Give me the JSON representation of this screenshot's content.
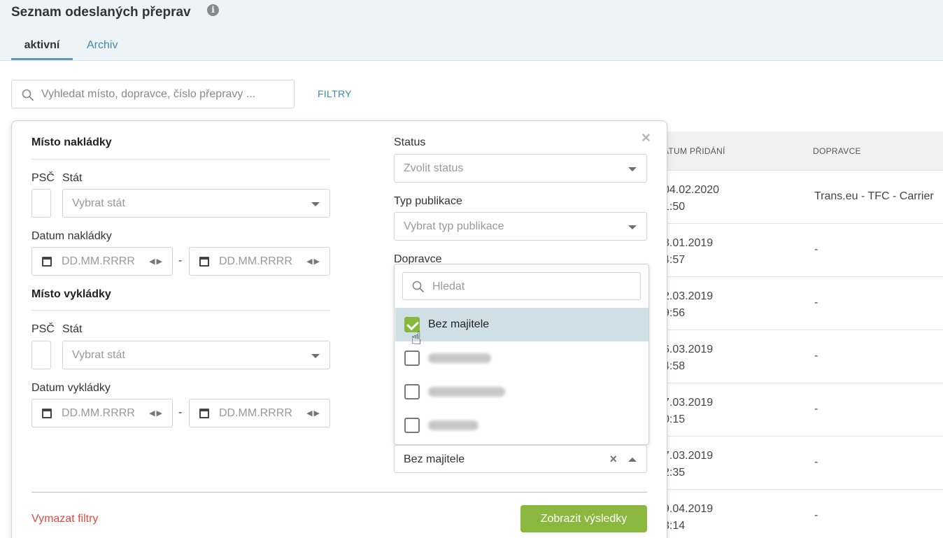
{
  "header": {
    "title": "Seznam odeslaných přeprav",
    "info_icon": "i",
    "tabs": [
      {
        "label": "aktivní",
        "active": true
      },
      {
        "label": "Archiv",
        "active": false
      }
    ]
  },
  "toolbar": {
    "search_placeholder": "Vyhledat místo, dopravce, číslo přepravy ...",
    "filters_label": "FILTRY"
  },
  "table": {
    "columns": [
      "ATUM PŘIDÁNÍ",
      "DOPRAVCE"
    ],
    "rows": [
      {
        "date": "04.02.2020",
        "time": "1:50",
        "carrier": "Trans.eu - TFC - Carrier"
      },
      {
        "date": "8.01.2019",
        "time": "4:57",
        "carrier": "-"
      },
      {
        "date": "2.03.2019",
        "time": "9:56",
        "carrier": "-"
      },
      {
        "date": "6.03.2019",
        "time": "4:58",
        "carrier": "-"
      },
      {
        "date": "7.03.2019",
        "time": "0:15",
        "carrier": "-"
      },
      {
        "date": "7.03.2019",
        "time": "2:35",
        "carrier": "-"
      },
      {
        "date": "9.04.2019",
        "time": "3:14",
        "carrier": "-"
      }
    ]
  },
  "filter_panel": {
    "close_label": "×",
    "loading": {
      "title": "Místo nakládky",
      "psc_label": "PSČ",
      "country_label": "Stát",
      "country_placeholder": "Vybrat stát",
      "date_label": "Datum nakládky",
      "date_from_placeholder": "DD.MM.RRRR",
      "date_to_placeholder": "DD.MM.RRRR",
      "date_separator": "-"
    },
    "unloading": {
      "title": "Místo vykládky",
      "psc_label": "PSČ",
      "country_label": "Stát",
      "country_placeholder": "Vybrat stát",
      "date_label": "Datum vykládky",
      "date_from_placeholder": "DD.MM.RRRR",
      "date_to_placeholder": "DD.MM.RRRR",
      "date_separator": "-"
    },
    "status": {
      "label": "Status",
      "placeholder": "Zvolit status"
    },
    "publication_type": {
      "label": "Typ publikace",
      "placeholder": "Vybrat typ publikace"
    },
    "carrier": {
      "label": "Dopravce",
      "selected_value": "Bez majitele",
      "clear_label": "×",
      "search_placeholder": "Hledat",
      "options": [
        {
          "label": "Bez majitele",
          "checked": true,
          "blurred": false
        },
        {
          "label": "",
          "checked": false,
          "blurred": true
        },
        {
          "label": "",
          "checked": false,
          "blurred": true
        },
        {
          "label": "",
          "checked": false,
          "blurred": true
        }
      ]
    },
    "clear_filters_label": "Vymazat filtry",
    "show_results_label": "Zobrazit výsledky"
  },
  "colors": {
    "accent_blue": "#3f8aab",
    "tab_underline": "#5d9bb4",
    "primary_button": "#8ab73d",
    "checkbox_checked": "#86b83a",
    "danger_link": "#e04a3f",
    "selected_option_bg": "#cfdfe5"
  },
  "icons": {
    "search": "search-icon",
    "calendar": "calendar-icon",
    "info": "info-icon",
    "close": "close-icon",
    "hand_cursor": "hand-pointer-icon"
  }
}
